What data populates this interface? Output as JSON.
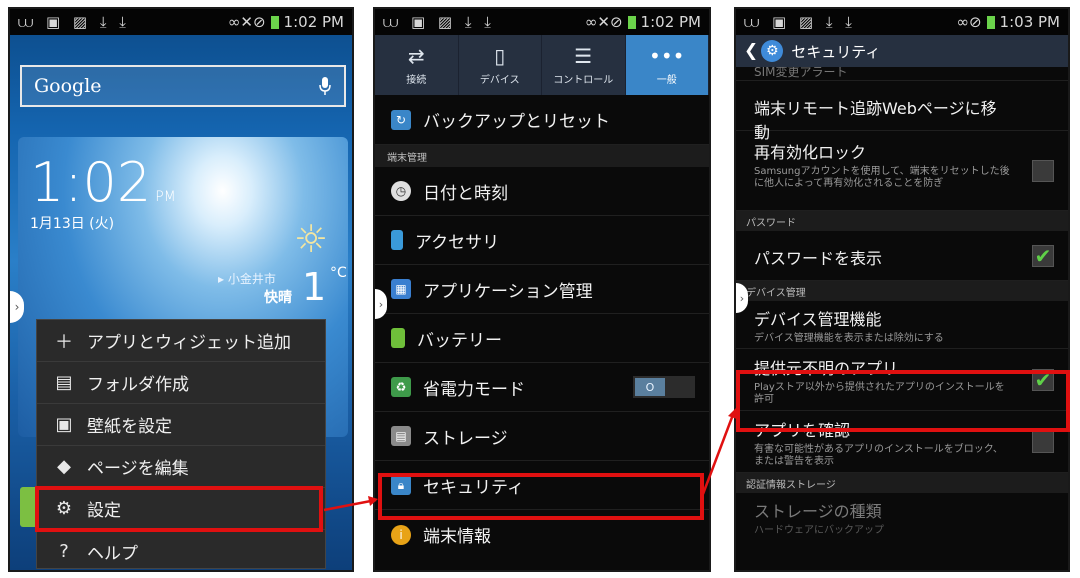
{
  "screen1": {
    "status": {
      "left": "⩊ ▣ ▨ ⤓ ⤓",
      "right": "∞✕⊘",
      "time": "1:02 PM"
    },
    "search": {
      "label": "Google",
      "mic_icon": "mic-icon"
    },
    "clock": {
      "time": "1:02",
      "ampm": "PM",
      "date": "1月13日 (火)"
    },
    "weather": {
      "city": "▸ 小金井市",
      "condition": "快晴",
      "temp": "1",
      "unit": "°C"
    },
    "menu": [
      {
        "label": "アプリとウィジェット追加",
        "icon": "＋"
      },
      {
        "label": "フォルダ作成",
        "icon": "▤"
      },
      {
        "label": "壁紙を設定",
        "icon": "▣"
      },
      {
        "label": "ページを編集",
        "icon": "◆"
      },
      {
        "label": "設定",
        "icon": "⚙"
      },
      {
        "label": "ヘルプ",
        "icon": "?"
      }
    ]
  },
  "screen2": {
    "status": {
      "left": "⩊ ▣ ▨ ⤓ ⤓",
      "right": "∞✕⊘",
      "time": "1:02 PM"
    },
    "tabs": [
      {
        "label": "接続",
        "icon": "⇄"
      },
      {
        "label": "デバイス",
        "icon": "▯"
      },
      {
        "label": "コントロール",
        "icon": "☰"
      },
      {
        "label": "一般",
        "icon": "•••"
      }
    ],
    "backup": "バックアップとリセット",
    "section": "端末管理",
    "items": [
      {
        "label": "日付と時刻",
        "color": "#e0e0e0"
      },
      {
        "label": "アクセサリ",
        "color": "#3a9ad9"
      },
      {
        "label": "アプリケーション管理",
        "color": "#3a7fd0"
      },
      {
        "label": "バッテリー",
        "color": "#6fbf3a"
      },
      {
        "label": "省電力モード",
        "color": "#3e9a4a"
      },
      {
        "label": "ストレージ",
        "color": "#8a8a8a"
      },
      {
        "label": "セキュリティ",
        "color": "#3a86c8"
      },
      {
        "label": "端末情報",
        "color": "#e8a317"
      }
    ],
    "toggle_label": "O"
  },
  "screen3": {
    "status": {
      "left": "⩊ ▣ ▨ ⤓ ⤓",
      "right": "∞⊘",
      "time": "1:03 PM"
    },
    "title": "セキュリティ",
    "cut": "SIM変更アラート",
    "remote": "端末リモート追跡Webページに移動",
    "reactivation": {
      "title": "再有効化ロック",
      "sub": "Samsungアカウントを使用して、端末をリセットした後に他人によって再有効化されることを防ぎ"
    },
    "sec_password": "パスワード",
    "show_password": "パスワードを表示",
    "sec_device": "デバイス管理",
    "device_admin": {
      "title": "デバイス管理機能",
      "sub": "デバイス管理機能を表示または除効にする"
    },
    "unknown": {
      "title": "提供元不明のアプリ",
      "sub": "Playストア以外から提供されたアプリのインストールを許可"
    },
    "verify": {
      "title": "アプリを確認",
      "sub": "有害な可能性があるアプリのインストールをブロック、または警告を表示"
    },
    "sec_cred": "認証情報ストレージ",
    "storage_type": {
      "title": "ストレージの種類",
      "sub": "ハードウェアにバックアップ"
    },
    "check": "✔"
  },
  "colors": {
    "highlight": "#e01010",
    "accent": "#3a86c8",
    "check": "#5fd048"
  }
}
